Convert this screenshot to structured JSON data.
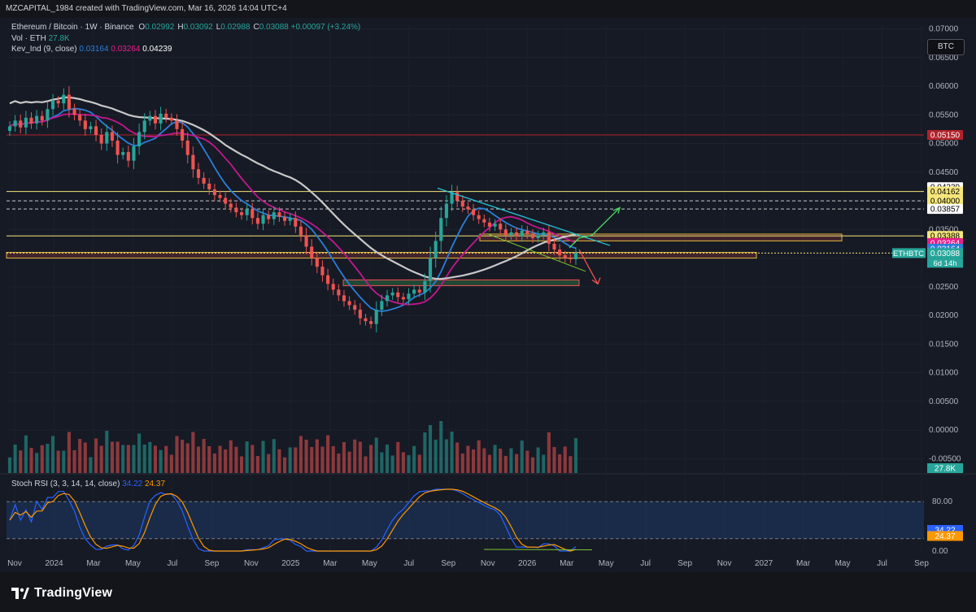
{
  "header": {
    "credit": "MZCAPITAL_1984 created with TradingView.com, Mar 16, 2026 14:04 UTC+4"
  },
  "symbol": {
    "title": "Ethereum / Bitcoin · 1W · Binance",
    "ohlc": [
      {
        "k": "O",
        "v": "0.02992"
      },
      {
        "k": "H",
        "v": "0.03092"
      },
      {
        "k": "L",
        "v": "0.02988"
      },
      {
        "k": "C",
        "v": "0.03088"
      }
    ],
    "change": "+0.00097 (+3.24%)"
  },
  "volume_legend": {
    "label": "Vol · ETH",
    "value": "27.8K"
  },
  "indicator_legend": {
    "label": "Kev_Ind (9, close)",
    "v1": "0.03164",
    "v2": "0.03264",
    "v3": "0.04239"
  },
  "currency_badge": "BTC",
  "stoch_legend": {
    "label": "Stoch RSI (3, 3, 14, 14, close)",
    "k": "34.22",
    "d": "24.37"
  },
  "footer": {
    "brand": "TradingView"
  },
  "colors": {
    "bg": "#161a25",
    "up": "#26a69a",
    "down": "#ef5350",
    "ma_gray": "#c8c8c8",
    "ma_magenta": "#c2188f",
    "ma_blue": "#2b7fd8"
  },
  "chart_data": {
    "type": "candlestick",
    "symbol": "ETHBTC",
    "timeframe": "1W",
    "exchange": "Binance",
    "price_axis": {
      "ticks": [
        "0.07000",
        "0.06500",
        "0.06000",
        "0.05500",
        "0.05000",
        "0.04500",
        "0.04000",
        "0.03500",
        "0.03000",
        "0.02500",
        "0.02000",
        "0.01500",
        "0.01000",
        "0.00500",
        "0.00000",
        "-0.00500"
      ],
      "range": [
        -0.0075,
        0.0705
      ]
    },
    "x_axis_labels": [
      "Nov",
      "2024",
      "Mar",
      "May",
      "Jul",
      "Sep",
      "Nov",
      "2025",
      "Mar",
      "May",
      "Jul",
      "Sep",
      "Nov",
      "2026",
      "Mar",
      "May",
      "Jul",
      "Sep",
      "Nov",
      "2027",
      "Mar",
      "May",
      "Jul",
      "Sep"
    ],
    "price_labels": [
      {
        "value": "0.05150",
        "color": "#b2222a",
        "text_color": "#ffffff"
      },
      {
        "value": "0.04239",
        "color": "#ffffff",
        "text_color": "#000000"
      },
      {
        "value": "0.04162",
        "color": "#f5e57a",
        "text_color": "#000000"
      },
      {
        "value": "0.04000",
        "color": "#f5e57a",
        "text_color": "#000000"
      },
      {
        "value": "0.03857",
        "color": "#ffffff",
        "text_color": "#000000"
      },
      {
        "value": "0.03388",
        "color": "#f5e57a",
        "text_color": "#000000"
      },
      {
        "value": "0.03264",
        "color": "#e91e8c",
        "text_color": "#ffffff"
      },
      {
        "value": "0.03164",
        "color": "#2b7fd8",
        "text_color": "#ffffff"
      },
      {
        "value": "0.03088",
        "color": "#26a69a",
        "text_color": "#ffffff"
      }
    ],
    "last_price": {
      "symbol": "ETHBTC",
      "value": "0.03088",
      "countdown": "6d 14h"
    },
    "close_series": [
      0.053,
      0.054,
      0.0528,
      0.0545,
      0.0535,
      0.0548,
      0.054,
      0.056,
      0.0575,
      0.057,
      0.0585,
      0.056,
      0.055,
      0.054,
      0.0525,
      0.053,
      0.0515,
      0.05,
      0.052,
      0.0505,
      0.048,
      0.0485,
      0.047,
      0.0495,
      0.052,
      0.054,
      0.0548,
      0.0535,
      0.0552,
      0.0545,
      0.054,
      0.0525,
      0.0505,
      0.048,
      0.0455,
      0.044,
      0.043,
      0.042,
      0.041,
      0.0405,
      0.0395,
      0.0388,
      0.038,
      0.0375,
      0.0385,
      0.037,
      0.036,
      0.0375,
      0.0368,
      0.038,
      0.0372,
      0.0365,
      0.037,
      0.0355,
      0.034,
      0.032,
      0.03,
      0.0285,
      0.027,
      0.0255,
      0.0245,
      0.0235,
      0.0225,
      0.0218,
      0.021,
      0.0195,
      0.019,
      0.0185,
      0.021,
      0.0225,
      0.0235,
      0.024,
      0.0232,
      0.0228,
      0.0238,
      0.0245,
      0.024,
      0.026,
      0.03,
      0.033,
      0.037,
      0.0395,
      0.0415,
      0.04,
      0.039,
      0.0385,
      0.0375,
      0.0368,
      0.0362,
      0.0355,
      0.036,
      0.035,
      0.034,
      0.0345,
      0.0338,
      0.0348,
      0.0342,
      0.0335,
      0.034,
      0.0345,
      0.0325,
      0.0315,
      0.0305,
      0.03,
      0.0298,
      0.0309
    ],
    "moving_averages": [
      {
        "name": "Kev_Ind 1",
        "color": "#2b7fd8",
        "last": 0.03164
      },
      {
        "name": "Kev_Ind 2",
        "color": "#c2188f",
        "last": 0.03264
      },
      {
        "name": "Kev_Ind 3",
        "color": "#c8c8c8",
        "last": 0.04239
      }
    ],
    "horizontal_levels": [
      0.0515,
      0.04162,
      0.04,
      0.03857,
      0.03388,
      0.03088
    ],
    "zones": [
      {
        "from": 0.033,
        "to": 0.0342,
        "color": "#e0b43a"
      },
      {
        "from": 0.03,
        "to": 0.031,
        "color": "#e0b43a"
      },
      {
        "from": 0.0252,
        "to": 0.0262,
        "color": "#3bb35a"
      }
    ],
    "volume": {
      "last": "27.8K"
    },
    "stoch_rsi": {
      "ticks": [
        "80.00",
        "0.00"
      ],
      "k_last": 34.22,
      "d_last": 24.37,
      "bands": [
        80,
        20
      ]
    }
  }
}
